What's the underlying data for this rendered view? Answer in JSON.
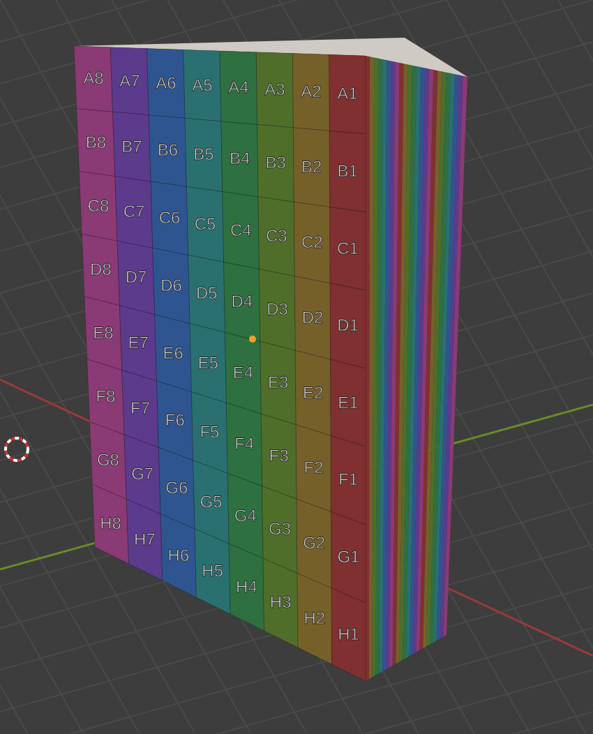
{
  "viewport": {
    "box": {
      "columns": [
        {
          "color": "#8a3a74"
        },
        {
          "color": "#5c3a8c"
        },
        {
          "color": "#2f5590"
        },
        {
          "color": "#2a7070"
        },
        {
          "color": "#2e7040"
        },
        {
          "color": "#4f6e2a"
        },
        {
          "color": "#76602a"
        },
        {
          "color": "#803030"
        }
      ],
      "rows": [
        {
          "labels": [
            "A8",
            "A7",
            "A6",
            "A5",
            "A4",
            "A3",
            "A2",
            "A1"
          ]
        },
        {
          "labels": [
            "B8",
            "B7",
            "B6",
            "B5",
            "B4",
            "B3",
            "B2",
            "B1"
          ]
        },
        {
          "labels": [
            "C8",
            "C7",
            "C6",
            "C5",
            "C4",
            "C3",
            "C2",
            "C1"
          ]
        },
        {
          "labels": [
            "D8",
            "D7",
            "D6",
            "D5",
            "D4",
            "D3",
            "D2",
            "D1"
          ]
        },
        {
          "labels": [
            "E8",
            "E7",
            "E6",
            "E5",
            "E4",
            "E3",
            "E2",
            "E1"
          ]
        },
        {
          "labels": [
            "F8",
            "F7",
            "F6",
            "F5",
            "F4",
            "F3",
            "F2",
            "F1"
          ]
        },
        {
          "labels": [
            "G8",
            "G7",
            "G6",
            "G5",
            "G4",
            "G3",
            "G2",
            "G1"
          ]
        },
        {
          "labels": [
            "H8",
            "H7",
            "H6",
            "H5",
            "H4",
            "H3",
            "H2",
            "H1"
          ]
        }
      ]
    }
  }
}
